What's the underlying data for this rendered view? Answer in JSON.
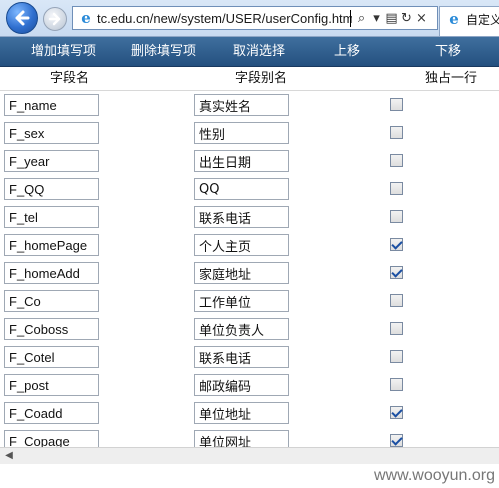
{
  "browser": {
    "url": "tc.edu.cn/new/system/USER/userConfig.htm",
    "tools": {
      "search": "⌕",
      "dropdown": "▾",
      "compat": "▤",
      "refresh": "↻",
      "close": "×"
    },
    "tab_title": "自定义"
  },
  "toolbar": {
    "add": "增加填写项",
    "delete": "删除填写项",
    "cancel": "取消选择",
    "move_up": "上移",
    "move_down": "下移"
  },
  "table": {
    "headers": {
      "field": "字段名",
      "alias": "字段别名",
      "single_line": "独占一行"
    },
    "rows": [
      {
        "field": "F_name",
        "alias": "真实姓名",
        "checked": false
      },
      {
        "field": "F_sex",
        "alias": "性别",
        "checked": false
      },
      {
        "field": "F_year",
        "alias": "出生日期",
        "checked": false
      },
      {
        "field": "F_QQ",
        "alias": "QQ",
        "checked": false
      },
      {
        "field": "F_tel",
        "alias": "联系电话",
        "checked": false
      },
      {
        "field": "F_homePage",
        "alias": "个人主页",
        "checked": true
      },
      {
        "field": "F_homeAdd",
        "alias": "家庭地址",
        "checked": true
      },
      {
        "field": "F_Co",
        "alias": "工作单位",
        "checked": false
      },
      {
        "field": "F_Coboss",
        "alias": "单位负责人",
        "checked": false
      },
      {
        "field": "F_Cotel",
        "alias": "联系电话",
        "checked": false
      },
      {
        "field": "F_post",
        "alias": "邮政编码",
        "checked": false
      },
      {
        "field": "F_Coadd",
        "alias": "单位地址",
        "checked": true
      },
      {
        "field": "F_Copage",
        "alias": "单位网址",
        "checked": true
      }
    ]
  },
  "watermark": "www.wooyun.org"
}
